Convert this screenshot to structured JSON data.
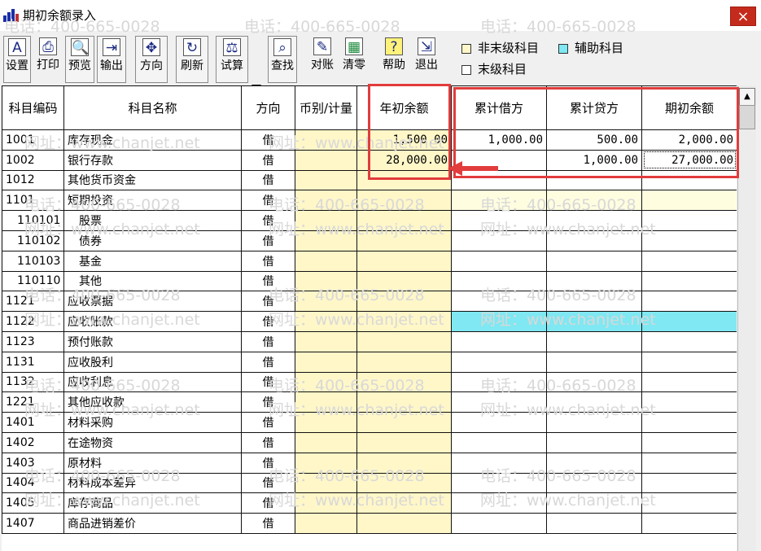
{
  "window": {
    "title": "期初余额录入",
    "close_label": "×"
  },
  "toolbar": {
    "buttons": [
      {
        "label": "设置",
        "icon": "setup-icon",
        "glyph": "A"
      },
      {
        "label": "打印",
        "icon": "printer-icon",
        "glyph": "⎙"
      },
      {
        "label": "预览",
        "icon": "preview-icon",
        "glyph": "🔍"
      },
      {
        "label": "输出",
        "icon": "export-icon",
        "glyph": "⇥"
      },
      {
        "label": "方向",
        "icon": "direction-icon",
        "glyph": "✥"
      },
      {
        "label": "刷新",
        "icon": "refresh-icon",
        "glyph": "↻"
      },
      {
        "label": "试算",
        "icon": "balance-scale-icon",
        "glyph": "⚖"
      },
      {
        "label": "查找",
        "icon": "find-icon",
        "glyph": "⌕"
      },
      {
        "label": "对账",
        "icon": "reconcile-icon",
        "glyph": "✎"
      },
      {
        "label": "清零",
        "icon": "clear-zero-icon",
        "glyph": "▦"
      },
      {
        "label": "帮助",
        "icon": "help-icon",
        "glyph": "?"
      },
      {
        "label": "退出",
        "icon": "exit-icon",
        "glyph": "⇲"
      }
    ]
  },
  "legend": {
    "non_leaf": "非末级科目",
    "auxiliary": "辅助科目",
    "leaf": "末级科目",
    "colors": {
      "non_leaf": "#fff7c8",
      "auxiliary": "#7fe8f2",
      "leaf": "#ffffff"
    }
  },
  "columns": [
    "科目编码",
    "科目名称",
    "方向",
    "币别/计量",
    "年初余额",
    "累计借方",
    "累计贷方",
    "期初余额"
  ],
  "rows": [
    {
      "code": "1001",
      "name": "库存现金",
      "dir": "借",
      "cur": "",
      "open": "1,500.00",
      "debit": "1,000.00",
      "credit": "500.00",
      "bal": "2,000.00"
    },
    {
      "code": "1002",
      "name": "银行存款",
      "dir": "借",
      "cur": "",
      "open": "28,000.00",
      "debit": "",
      "credit": "1,000.00",
      "bal": "27,000.00"
    },
    {
      "code": "1012",
      "name": "其他货币资金",
      "dir": "借",
      "cur": "",
      "open": "",
      "debit": "",
      "credit": "",
      "bal": ""
    },
    {
      "code": "1101",
      "name": "短期投资",
      "dir": "借",
      "cur": "",
      "open": "",
      "debit": "",
      "credit": "",
      "bal": ""
    },
    {
      "code": "110101",
      "name": "股票",
      "dir": "借",
      "cur": "",
      "open": "",
      "debit": "",
      "credit": "",
      "bal": ""
    },
    {
      "code": "110102",
      "name": "债券",
      "dir": "借",
      "cur": "",
      "open": "",
      "debit": "",
      "credit": "",
      "bal": ""
    },
    {
      "code": "110103",
      "name": "基金",
      "dir": "借",
      "cur": "",
      "open": "",
      "debit": "",
      "credit": "",
      "bal": ""
    },
    {
      "code": "110110",
      "name": "其他",
      "dir": "借",
      "cur": "",
      "open": "",
      "debit": "",
      "credit": "",
      "bal": ""
    },
    {
      "code": "1121",
      "name": "应收票据",
      "dir": "借",
      "cur": "",
      "open": "",
      "debit": "",
      "credit": "",
      "bal": ""
    },
    {
      "code": "1122",
      "name": "应收账款",
      "dir": "借",
      "cur": "",
      "open": "",
      "debit": "",
      "credit": "",
      "bal": ""
    },
    {
      "code": "1123",
      "name": "预付账款",
      "dir": "借",
      "cur": "",
      "open": "",
      "debit": "",
      "credit": "",
      "bal": ""
    },
    {
      "code": "1131",
      "name": "应收股利",
      "dir": "借",
      "cur": "",
      "open": "",
      "debit": "",
      "credit": "",
      "bal": ""
    },
    {
      "code": "1132",
      "name": "应收利息",
      "dir": "借",
      "cur": "",
      "open": "",
      "debit": "",
      "credit": "",
      "bal": ""
    },
    {
      "code": "1221",
      "name": "其他应收款",
      "dir": "借",
      "cur": "",
      "open": "",
      "debit": "",
      "credit": "",
      "bal": ""
    },
    {
      "code": "1401",
      "name": "材料采购",
      "dir": "借",
      "cur": "",
      "open": "",
      "debit": "",
      "credit": "",
      "bal": ""
    },
    {
      "code": "1402",
      "name": "在途物资",
      "dir": "借",
      "cur": "",
      "open": "",
      "debit": "",
      "credit": "",
      "bal": ""
    },
    {
      "code": "1403",
      "name": "原材料",
      "dir": "借",
      "cur": "",
      "open": "",
      "debit": "",
      "credit": "",
      "bal": ""
    },
    {
      "code": "1404",
      "name": "材料成本差异",
      "dir": "借",
      "cur": "",
      "open": "",
      "debit": "",
      "credit": "",
      "bal": ""
    },
    {
      "code": "1405",
      "name": "库存商品",
      "dir": "借",
      "cur": "",
      "open": "",
      "debit": "",
      "credit": "",
      "bal": ""
    },
    {
      "code": "1407",
      "name": "商品进销差价",
      "dir": "借",
      "cur": "",
      "open": "",
      "debit": "",
      "credit": "",
      "bal": ""
    }
  ],
  "watermark": {
    "phone": "电话：400-665-0028",
    "site": "网址：www.chanjet.net"
  }
}
